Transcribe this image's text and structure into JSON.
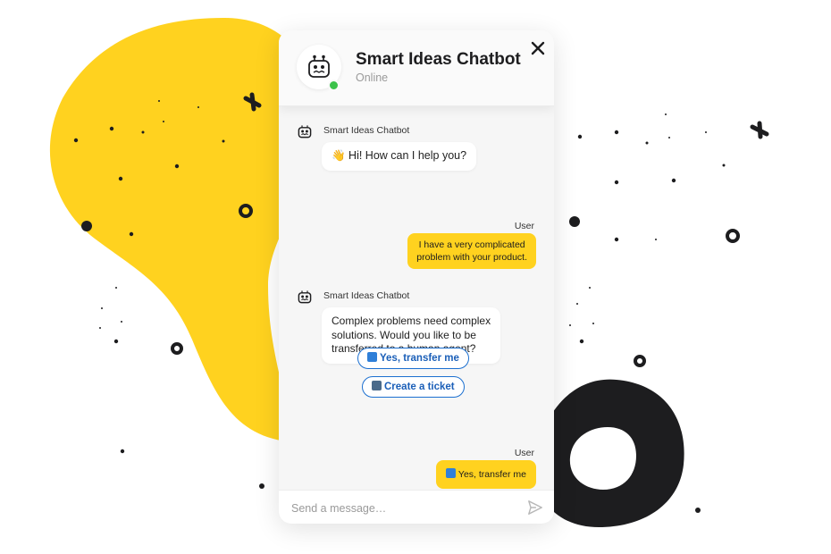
{
  "chat": {
    "title": "Smart Ideas Chatbot",
    "status": "Online",
    "close_icon": "close-icon",
    "avatar_icon": "robot-icon"
  },
  "messages": [
    {
      "from": "bot",
      "sender": "Smart Ideas Chatbot",
      "text": "👋 Hi! How can I help you?"
    },
    {
      "from": "user",
      "sender": "User",
      "lines": [
        "I have a very complicated",
        "problem with your product."
      ]
    },
    {
      "from": "bot",
      "sender": "Smart Ideas Chatbot",
      "lines": [
        "Complex problems need complex",
        "solutions. Would you like to be",
        "transferred to a human agent?"
      ]
    },
    {
      "from": "user",
      "sender": "User",
      "text": "Yes, transfer me"
    }
  ],
  "quick_replies": [
    {
      "label": "Yes, transfer me",
      "icon": "arrow-right-icon"
    },
    {
      "label": "Create a ticket",
      "icon": "mailbox-icon"
    }
  ],
  "composer": {
    "placeholder": "Send a message…",
    "send_icon": "send-icon"
  },
  "colors": {
    "accent_yellow": "#ffd21f",
    "link_blue": "#1b6fd0",
    "online_green": "#3bc24a",
    "dark_blob": "#1d1d1f"
  }
}
